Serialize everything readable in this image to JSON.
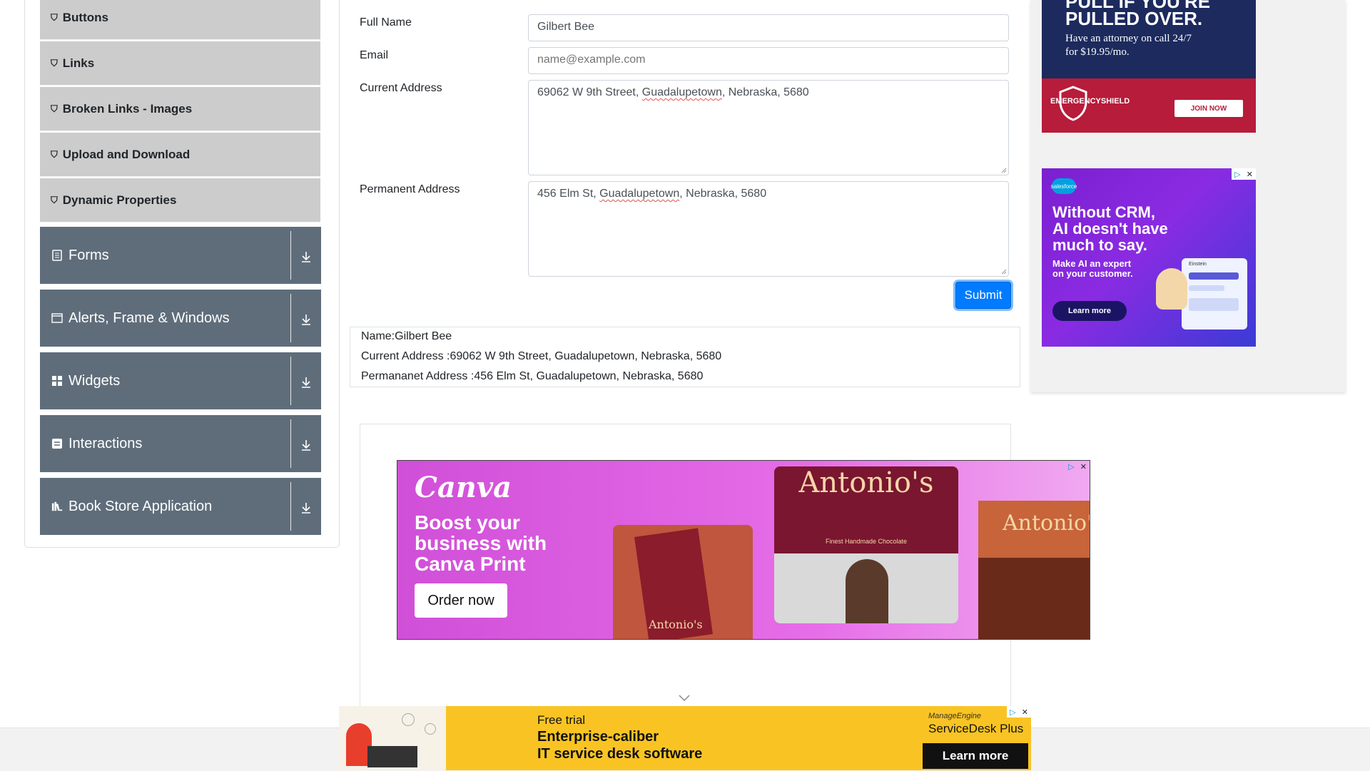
{
  "sidebar": {
    "sub_items": [
      {
        "label": "Buttons",
        "icon": "html5-icon"
      },
      {
        "label": "Links",
        "icon": "html5-icon"
      },
      {
        "label": "Broken Links - Images",
        "icon": "html5-icon"
      },
      {
        "label": "Upload and Download",
        "icon": "html5-icon"
      },
      {
        "label": "Dynamic Properties",
        "icon": "html5-icon"
      }
    ],
    "groups": [
      {
        "label": "Forms",
        "icon": "form-icon"
      },
      {
        "label": "Alerts, Frame & Windows",
        "icon": "window-icon"
      },
      {
        "label": "Widgets",
        "icon": "widgets-icon"
      },
      {
        "label": "Interactions",
        "icon": "interactions-icon"
      },
      {
        "label": "Book Store Application",
        "icon": "books-icon"
      }
    ]
  },
  "form": {
    "full_name_label": "Full Name",
    "full_name_value": "Gilbert Bee",
    "email_label": "Email",
    "email_placeholder": "name@example.com",
    "current_address_label": "Current Address",
    "current_address_pre": "69062 W 9th Street, ",
    "current_address_mid": "Guadalupetown",
    "current_address_post": ", Nebraska, 5680",
    "permanent_address_label": "Permanent Address",
    "permanent_address_pre": "456 Elm St, ",
    "permanent_address_mid": "Guadalupetown",
    "permanent_address_post": ", Nebraska, 5680",
    "submit_label": "Submit"
  },
  "output": {
    "name": "Name:Gilbert Bee",
    "current_address": "Current Address :69062 W 9th Street, Guadalupetown, Nebraska, 5680",
    "permanent_address": "Permananet Address :456 Elm St, Guadalupetown, Nebraska, 5680"
  },
  "ads": {
    "top_right": {
      "headline_1": "PULL IF YOU'RE",
      "headline_2": "PULLED OVER.",
      "body_1": "Have an attorney on call 24/7",
      "body_2": "for $19.95/mo.",
      "brand": "EMERGENCYSHIELD",
      "cta": "JOIN NOW",
      "accent_color": "#b71c3a",
      "bg_color": "#1c2a5e"
    },
    "salesforce": {
      "brand": "salesforce",
      "headline_1": "Without CRM,",
      "headline_2": "AI doesn't have",
      "headline_3": "much to say.",
      "body_1": "Make AI an expert",
      "body_2": "on your customer.",
      "cta": "Learn more",
      "panel_title": "Einstein"
    },
    "canva": {
      "brand": "Canva",
      "headline_1": "Boost your",
      "headline_2": "business with",
      "headline_3": "Canva Print",
      "cta": "Order now",
      "product_brand": "Antonio's",
      "product_tagline": "Finest Handmade Chocolate"
    },
    "bottom": {
      "line_1": "Free trial",
      "line_2": "Enterprise-caliber",
      "line_3": "IT service desk software",
      "brand_1": "ManageEngine",
      "brand_2": "ServiceDesk Plus",
      "cta": "Learn more"
    }
  }
}
